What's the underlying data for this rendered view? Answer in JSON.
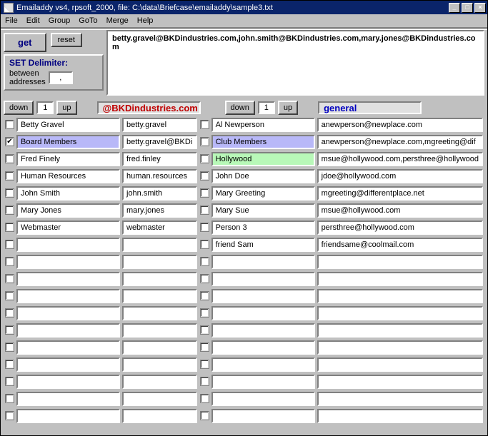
{
  "title": "Emailaddy vs4, rpsoft_2000, file: C:\\data\\Briefcase\\emailaddy\\sample3.txt",
  "window_controls": {
    "min": "_",
    "max": "□",
    "close": "×"
  },
  "menu": [
    "File",
    "Edit",
    "Group",
    "GoTo",
    "Merge",
    "Help"
  ],
  "buttons": {
    "get": "get",
    "reset": "reset"
  },
  "delimiter": {
    "title": "SET Delimiter:",
    "between_label": "between",
    "addresses_label": "addresses",
    "value": ","
  },
  "output": "betty.gravel@BKDindustries.com,john.smith@BKDindustries.com,mary.jones@BKDindustries.com",
  "left_panel": {
    "down": "down",
    "up": "up",
    "index": "1",
    "header": "@BKDindustries.com",
    "rows": [
      {
        "checked": false,
        "name": "Betty Gravel",
        "value": "betty.gravel",
        "hl": ""
      },
      {
        "checked": true,
        "name": "Board Members",
        "value": "betty.gravel@BKDi",
        "hl": "blue"
      },
      {
        "checked": false,
        "name": "Fred Finely",
        "value": "fred.finley",
        "hl": ""
      },
      {
        "checked": false,
        "name": "Human Resources",
        "value": "human.resources",
        "hl": ""
      },
      {
        "checked": false,
        "name": "John Smith",
        "value": "john.smith",
        "hl": ""
      },
      {
        "checked": false,
        "name": "Mary Jones",
        "value": "mary.jones",
        "hl": ""
      },
      {
        "checked": false,
        "name": "Webmaster",
        "value": "webmaster",
        "hl": ""
      },
      {
        "checked": false,
        "name": "",
        "value": "",
        "hl": ""
      },
      {
        "checked": false,
        "name": "",
        "value": "",
        "hl": ""
      },
      {
        "checked": false,
        "name": "",
        "value": "",
        "hl": ""
      },
      {
        "checked": false,
        "name": "",
        "value": "",
        "hl": ""
      },
      {
        "checked": false,
        "name": "",
        "value": "",
        "hl": ""
      },
      {
        "checked": false,
        "name": "",
        "value": "",
        "hl": ""
      },
      {
        "checked": false,
        "name": "",
        "value": "",
        "hl": ""
      },
      {
        "checked": false,
        "name": "",
        "value": "",
        "hl": ""
      },
      {
        "checked": false,
        "name": "",
        "value": "",
        "hl": ""
      },
      {
        "checked": false,
        "name": "",
        "value": "",
        "hl": ""
      },
      {
        "checked": false,
        "name": "",
        "value": "",
        "hl": ""
      }
    ]
  },
  "right_panel": {
    "down": "down",
    "up": "up",
    "index": "1",
    "header": "general",
    "rows": [
      {
        "checked": false,
        "name": "Al Newperson",
        "value": "anewperson@newplace.com",
        "hl": ""
      },
      {
        "checked": false,
        "name": "Club Members",
        "value": "anewperson@newplace.com,mgreeting@dif",
        "hl": "blue"
      },
      {
        "checked": false,
        "name": "Hollywood",
        "value": "msue@hollywood.com,persthree@hollywood",
        "hl": "green"
      },
      {
        "checked": false,
        "name": "John Doe",
        "value": "jdoe@hollywood.com",
        "hl": ""
      },
      {
        "checked": false,
        "name": "Mary Greeting",
        "value": "mgreeting@differentplace.net",
        "hl": ""
      },
      {
        "checked": false,
        "name": "Mary Sue",
        "value": "msue@hollywood.com",
        "hl": ""
      },
      {
        "checked": false,
        "name": "Person 3",
        "value": "persthree@hollywood.com",
        "hl": ""
      },
      {
        "checked": false,
        "name": "friend Sam",
        "value": "friendsame@coolmail.com",
        "hl": ""
      },
      {
        "checked": false,
        "name": "",
        "value": "",
        "hl": ""
      },
      {
        "checked": false,
        "name": "",
        "value": "",
        "hl": ""
      },
      {
        "checked": false,
        "name": "",
        "value": "",
        "hl": ""
      },
      {
        "checked": false,
        "name": "",
        "value": "",
        "hl": ""
      },
      {
        "checked": false,
        "name": "",
        "value": "",
        "hl": ""
      },
      {
        "checked": false,
        "name": "",
        "value": "",
        "hl": ""
      },
      {
        "checked": false,
        "name": "",
        "value": "",
        "hl": ""
      },
      {
        "checked": false,
        "name": "",
        "value": "",
        "hl": ""
      },
      {
        "checked": false,
        "name": "",
        "value": "",
        "hl": ""
      },
      {
        "checked": false,
        "name": "",
        "value": "",
        "hl": ""
      }
    ]
  }
}
